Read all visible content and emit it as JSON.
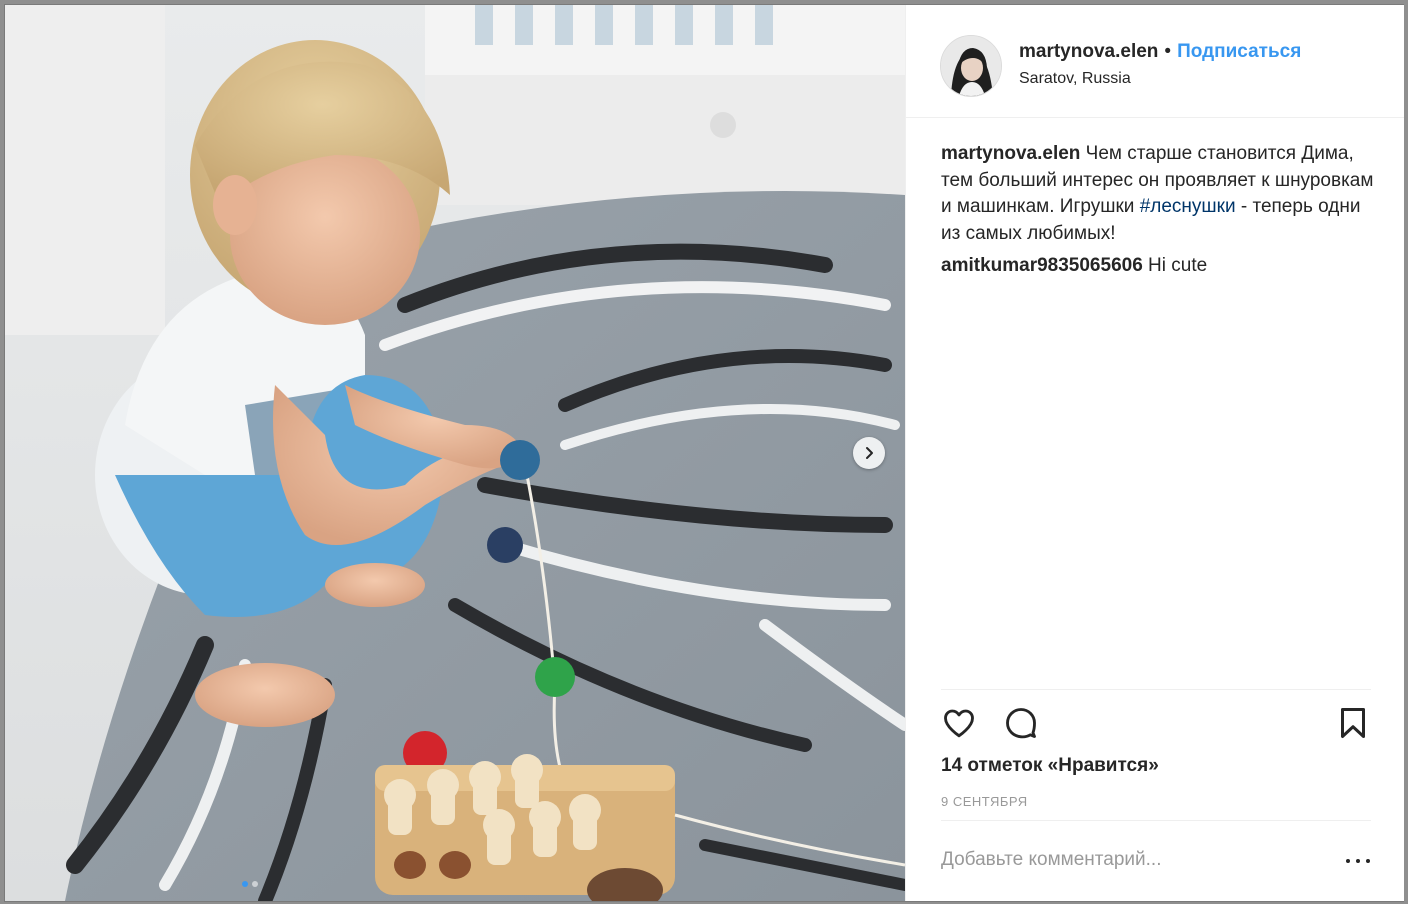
{
  "post": {
    "username": "martynova.elen",
    "separator": "•",
    "follow_label": "Подписаться",
    "location": "Saratov, Russia"
  },
  "caption": {
    "username": "martynova.elen",
    "text_before": " Чем старше становится Дима, тем больший интерес он проявляет к шнуровкам и машинкам. Игрушки ",
    "hashtag": "#леснушки",
    "text_after": " - теперь одни из самых любимых!"
  },
  "comments": [
    {
      "username": "amitkumar9835065606",
      "text": " Hi cute"
    }
  ],
  "actions": {
    "like_icon": "heart-icon",
    "comment_icon": "speech-bubble-icon",
    "save_icon": "bookmark-icon"
  },
  "likes_text": "14 отметок «Нравится»",
  "date_text": "9 сентября",
  "add_comment_placeholder": "Добавьте комментарий...",
  "carousel": {
    "slides": 2,
    "active": 0,
    "next_icon": "chevron-right-icon"
  },
  "colors": {
    "accent": "#3897f0",
    "text": "#262626",
    "muted": "#999999",
    "hashtag": "#003569"
  }
}
